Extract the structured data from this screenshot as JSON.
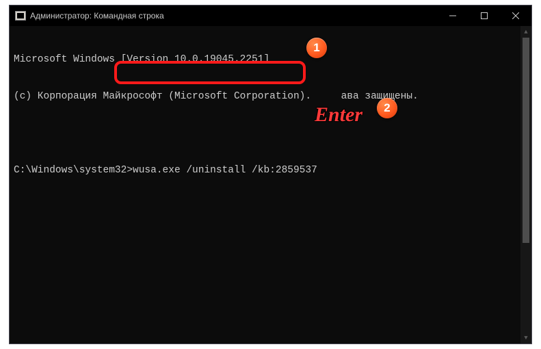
{
  "titlebar": {
    "title": "Администратор: Командная строка"
  },
  "console": {
    "line1": "Microsoft Windows [Version 10.0.19045.2251]",
    "line2_left": "(c) Корпорация Майкрософт (Microsoft Corporation). ",
    "line2_right": "ава защищены.",
    "prompt": "C:\\Windows\\system32>",
    "command": "wusa.exe /uninstall /kb:2859537"
  },
  "badges": {
    "b1": "1",
    "b2": "2"
  },
  "annotation": {
    "enter": "Enter"
  }
}
